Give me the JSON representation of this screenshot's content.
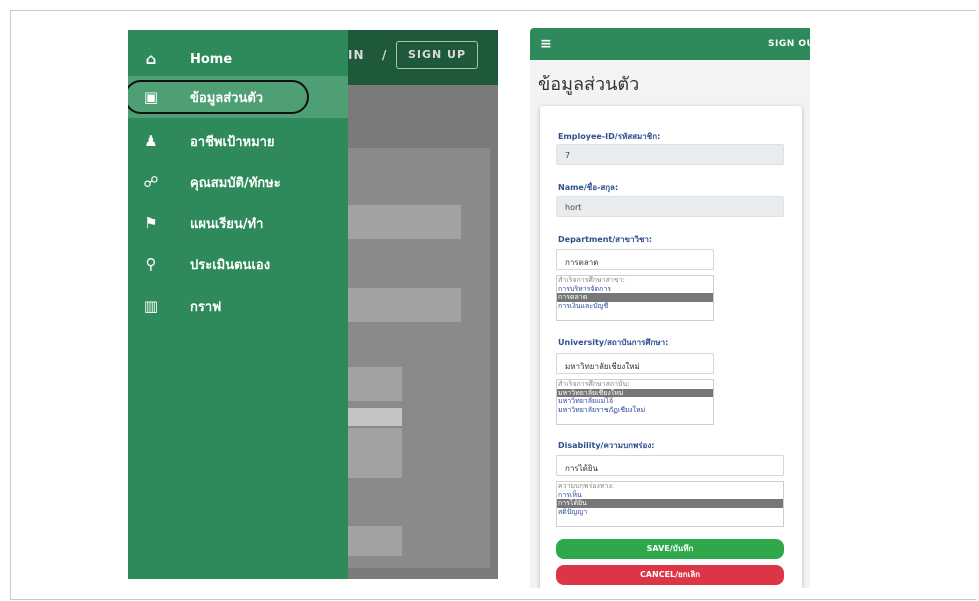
{
  "left_panel": {
    "background_topbar": {
      "signin_text": "IN",
      "separator": "/",
      "signup_label": "SIGN UP"
    },
    "drawer": {
      "items": [
        {
          "label": "Home",
          "icon": "home-icon",
          "glyph": "⌂"
        },
        {
          "label": "ข้อมูลส่วนตัว",
          "icon": "contact-card-icon",
          "glyph": "▣",
          "active": true
        },
        {
          "label": "อาชีพเป้าหมาย",
          "icon": "person-target-icon",
          "glyph": "♟"
        },
        {
          "label": "คุณสมบัติ/ทักษะ",
          "icon": "person-skill-icon",
          "glyph": "☍"
        },
        {
          "label": "แผนเรียน/ทำ",
          "icon": "running-person-icon",
          "glyph": "⚑"
        },
        {
          "label": "ประเมินตนเอง",
          "icon": "person-search-icon",
          "glyph": "⚲"
        },
        {
          "label": "กราฟ",
          "icon": "bar-chart-icon",
          "glyph": "▥"
        }
      ]
    }
  },
  "right_panel": {
    "appbar": {
      "menu_icon": "hamburger-menu-icon",
      "menu_glyph": "≡",
      "signout_label": "SIGN OUT"
    },
    "page_title": "ข้อมูลส่วนตัว",
    "form": {
      "employee_id": {
        "label": "Employee-ID/รหัสสมาชิก:",
        "value": "7"
      },
      "name": {
        "label": "Name/ชื่อ-สกุล:",
        "value": "hort"
      },
      "department": {
        "label": "Department/สาขาวิชา:",
        "value": "การตลาด",
        "list_caption": "สำเร็จการศึกษาสาขา:",
        "options": [
          "การบริหารจัดการ",
          "การตลาด",
          "การเงินและบัญชี"
        ],
        "selected": "การตลาด"
      },
      "university": {
        "label": "University/สถาบันการศึกษา:",
        "value": "มหาวิทยาลัยเชียงใหม่",
        "list_caption": "สำเร็จการศึกษาสถาบัน:",
        "options": [
          "มหาวิทยาลัยเชียงใหม่",
          "มหาวิทยาลัยแม่โจ้",
          "มหาวิทยาลัยราชภัฏเชียงใหม่"
        ],
        "selected": "มหาวิทยาลัยเชียงใหม่"
      },
      "disability": {
        "label": "Disability/ความบกพร่อง:",
        "value": "การได้ยิน",
        "list_caption": "ความบกพร่องทาง:",
        "options": [
          "การเห็น",
          "การได้ยิน",
          "สติปัญญา"
        ],
        "selected": "การได้ยิน"
      },
      "save_label": "SAVE/บันทึก",
      "cancel_label": "CANCEL/ยกเลิก"
    }
  },
  "colors": {
    "brand_green": "#2e8a5a",
    "save_green": "#2ea84a",
    "cancel_red": "#dc3545",
    "label_blue": "#2f4f8f"
  }
}
